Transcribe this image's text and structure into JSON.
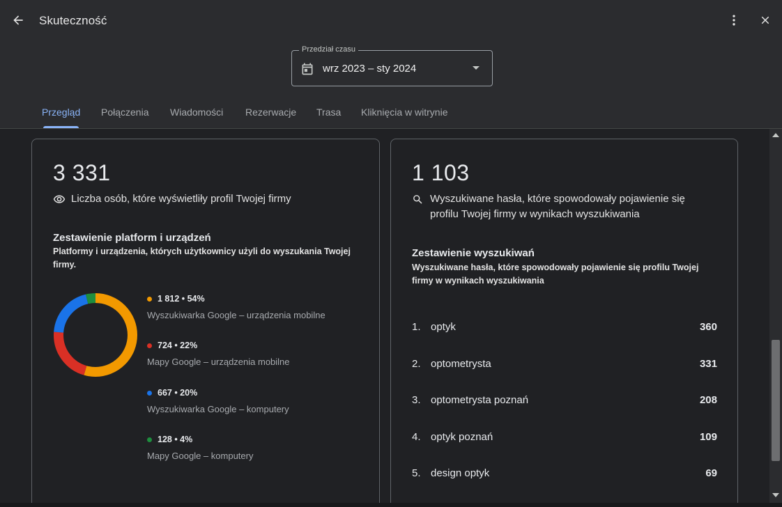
{
  "header": {
    "title": "Skuteczność"
  },
  "date_range": {
    "legend": "Przedział czasu",
    "value": "wrz 2023 – sty 2024"
  },
  "tabs": [
    {
      "label": "Przegląd",
      "active": true
    },
    {
      "label": "Połączenia",
      "active": false
    },
    {
      "label": "Wiadomości",
      "active": false
    },
    {
      "label": "Rezerwacje",
      "active": false
    },
    {
      "label": "Trasa",
      "active": false
    },
    {
      "label": "Kliknięcia w witrynie",
      "active": false
    }
  ],
  "profile_views": {
    "value": "3 331",
    "label": "Liczba osób, które wyświetliły profil Twojej firmy",
    "section_title": "Zestawienie platform i urządzeń",
    "section_subtitle": "Platformy i urządzenia, których użytkownicy użyli do wyszukania Twojej firmy.",
    "breakdown": [
      {
        "value": "1 812 • 54%",
        "count": 1812,
        "label": "Wyszukiwarka Google – urządzenia mobilne",
        "color": "#f29900"
      },
      {
        "value": "724 • 22%",
        "count": 724,
        "label": "Mapy Google – urządzenia mobilne",
        "color": "#d93025"
      },
      {
        "value": "667 • 20%",
        "count": 667,
        "label": "Wyszukiwarka Google – komputery",
        "color": "#1a73e8"
      },
      {
        "value": "128 • 4%",
        "count": 128,
        "label": "Mapy Google – komputery",
        "color": "#1e8e3e"
      }
    ]
  },
  "searches": {
    "value": "1 103",
    "label": "Wyszukiwane hasła, które spowodowały pojawienie się profilu Twojej firmy w wynikach wyszukiwania",
    "section_title": "Zestawienie wyszukiwań",
    "section_subtitle": "Wyszukiwane hasła, które spowodowały pojawienie się profilu Twojej firmy w wynikach wyszukiwania",
    "terms": [
      {
        "index": "1.",
        "term": "optyk",
        "count": "360"
      },
      {
        "index": "2.",
        "term": "optometrysta",
        "count": "331"
      },
      {
        "index": "3.",
        "term": "optometrysta poznań",
        "count": "208"
      },
      {
        "index": "4.",
        "term": "optyk poznań",
        "count": "109"
      },
      {
        "index": "5.",
        "term": "design optyk",
        "count": "69"
      }
    ]
  },
  "icons": {
    "back": "arrow-back-icon",
    "more": "more-vert-icon",
    "close": "close-icon",
    "calendar": "calendar-icon",
    "dropdown": "arrow-drop-down-icon",
    "views": "eye-icon",
    "search": "search-icon"
  },
  "colors": {
    "accent": "#8ab4f8",
    "background": "#202124",
    "header": "#2b2c2f"
  }
}
